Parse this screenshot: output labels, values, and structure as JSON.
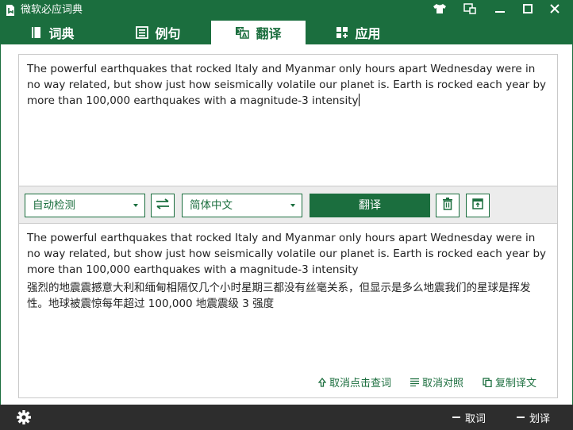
{
  "app": {
    "title": "微软必应词典",
    "icon": "bing-dictionary-icon"
  },
  "window_controls": [
    {
      "name": "skin-icon"
    },
    {
      "name": "mini-mode-icon"
    },
    {
      "name": "minimize-icon"
    },
    {
      "name": "maximize-icon"
    },
    {
      "name": "close-icon"
    }
  ],
  "tabs": [
    {
      "label": "词典",
      "icon": "book-icon",
      "active": false
    },
    {
      "label": "例句",
      "icon": "list-icon",
      "active": false
    },
    {
      "label": "翻译",
      "icon": "translate-icon",
      "active": true
    },
    {
      "label": "应用",
      "icon": "apps-icon",
      "active": false
    }
  ],
  "source": {
    "text": "The powerful earthquakes that rocked Italy and Myanmar only hours apart Wednesday were in no way related, but show just how seismically volatile our planet is. Earth is rocked each year by more than 100,000 earthquakes with a magnitude-3 intensity"
  },
  "toolbar": {
    "source_lang": "自动检测",
    "target_lang": "简体中文",
    "translate_label": "翻译",
    "swap_icon": "swap-arrows-icon",
    "clear_icon": "trash-icon",
    "popout_icon": "window-popout-icon"
  },
  "result": {
    "original": "The powerful earthquakes that rocked Italy and Myanmar only hours apart Wednesday were in no way related, but show just how seismically volatile our planet is. Earth is rocked each year by more than 100,000 earthquakes with a magnitude-3 intensity",
    "translation": "强烈的地震震撼意大利和缅甸相隔仅几个小时星期三都没有丝毫关系，但显示是多么地震我们的星球是挥发性。地球被震惊每年超过 100,000 地震震级 3 强度",
    "actions": [
      {
        "label": "取消点击查词",
        "icon": "cursor-icon"
      },
      {
        "label": "取消对照",
        "icon": "lines-icon"
      },
      {
        "label": "复制译文",
        "icon": "copy-icon"
      }
    ]
  },
  "bottombar": {
    "settings_icon": "gear-icon",
    "items": [
      {
        "label": "取词"
      },
      {
        "label": "划译"
      }
    ]
  },
  "colors": {
    "brand": "#1b6e3e",
    "bottombar": "#2d2d2d",
    "toolbar_bg": "#ececec"
  }
}
